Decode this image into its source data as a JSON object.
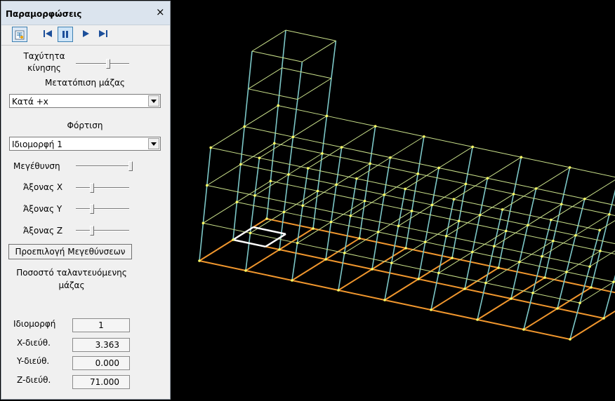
{
  "panel": {
    "title": "Παραμορφώσεις",
    "close_glyph": "×",
    "toolbar": {
      "options_icon": "deformation-options-icon",
      "first_icon": "skip-first-icon",
      "pause_icon": "pause-icon",
      "play_icon": "play-icon",
      "last_icon": "skip-last-icon"
    },
    "motion_speed": {
      "label_line1": "Ταχύτητα",
      "label_line2": "κίνησης",
      "value": 0.6
    },
    "mass_shift": {
      "label": "Μετατόπιση μάζας",
      "selected": "Κατά +x"
    },
    "loading": {
      "label": "Φόρτιση",
      "selected": "Ιδιομορφή 1"
    },
    "magnification": {
      "label": "Μεγέθυνση",
      "value": 1.0
    },
    "axis_x": {
      "label": "Άξονας X",
      "value": 0.3
    },
    "axis_y": {
      "label": "Άξονας Y",
      "value": 0.3
    },
    "axis_z": {
      "label": "Άξονας Z",
      "value": 0.3
    },
    "preset_button": "Προεπιλογή Μεγεθύνσεων",
    "mass_ratio_line1": "Ποσοστό ταλαντευόμενης",
    "mass_ratio_line2": "μάζας",
    "results": [
      {
        "label": "Ιδιομορφή",
        "value": "1"
      },
      {
        "label": "X-διεύθ.",
        "value": "3.363"
      },
      {
        "label": "Y-διεύθ.",
        "value": "0.000"
      },
      {
        "label": "Z-διεύθ.",
        "value": "71.000"
      }
    ]
  },
  "viewport": {
    "background": "#000000",
    "colors": {
      "base": "#f0962d",
      "columns": "#7cc7c7",
      "beams": "#c9e08a",
      "nodes": "#ffff66",
      "highlight": "#ffffff"
    }
  }
}
